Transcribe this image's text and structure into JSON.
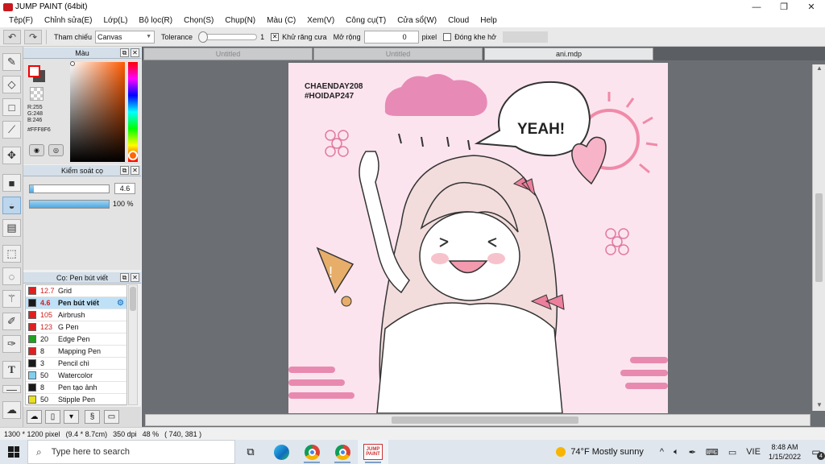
{
  "window": {
    "title": "JUMP PAINT (64bit)",
    "minimize": "—",
    "maximize": "❐",
    "close": "✕"
  },
  "menu": [
    "Tệp(F)",
    "Chỉnh sửa(E)",
    "Lớp(L)",
    "Bộ lọc(R)",
    "Chọn(S)",
    "Chụp(N)",
    "Màu (C)",
    "Xem(V)",
    "Công cụ(T)",
    "Cửa sổ(W)",
    "Cloud",
    "Help"
  ],
  "toolbar": {
    "reference_label": "Tham chiếu",
    "reference_value": "Canvas",
    "tolerance_label": "Tolerance",
    "tolerance_value": "1",
    "antialias_label": "Khử răng cưa",
    "antialias_checked": "✕",
    "expand_label": "Mở rộng",
    "expand_value": "0",
    "pixel_label": "pixel",
    "close_gap_label": "Đóng khe hở"
  },
  "color_panel": {
    "title": "Màu",
    "r": "R:255",
    "g": "G:248",
    "b": "B:246",
    "hex": "#FFF8F6"
  },
  "brush_control": {
    "title": "Kiểm soát cọ",
    "size_value": "4.6",
    "size_fraction": 0.05,
    "opacity_value": "100 %",
    "opacity_fraction": 1.0
  },
  "brush_panel": {
    "title": "Cọ: Pen bút viết",
    "brushes": [
      {
        "size": "12.7",
        "name": "Grid",
        "color": "#e02020",
        "size_red": true,
        "selected": false
      },
      {
        "size": "4.6",
        "name": "Pen bút viết",
        "color": "#1a1a1a",
        "size_red": true,
        "selected": true
      },
      {
        "size": "105",
        "name": "Airbrush",
        "color": "#e02020",
        "size_red": true,
        "selected": false
      },
      {
        "size": "123",
        "name": "G Pen",
        "color": "#e02020",
        "size_red": true,
        "selected": false
      },
      {
        "size": "20",
        "name": "Edge Pen",
        "color": "#20a020",
        "size_red": false,
        "selected": false
      },
      {
        "size": "8",
        "name": "Mapping Pen",
        "color": "#e02020",
        "size_red": false,
        "selected": false
      },
      {
        "size": "3",
        "name": "Pencil chì",
        "color": "#1a1a1a",
        "size_red": false,
        "selected": false
      },
      {
        "size": "50",
        "name": "Watercolor",
        "color": "#7fd0f0",
        "size_red": false,
        "selected": false
      },
      {
        "size": "8",
        "name": "Pen tạo ảnh",
        "color": "#1a1a1a",
        "size_red": false,
        "selected": false
      },
      {
        "size": "50",
        "name": "Stipple Pen",
        "color": "#e8e020",
        "size_red": false,
        "selected": false
      }
    ]
  },
  "tabs": [
    {
      "label": "Untitled",
      "active": false
    },
    {
      "label": "Untitled",
      "active": false
    },
    {
      "label": "ani.mdp",
      "active": true
    }
  ],
  "artwork": {
    "watermark_line1": "CHAENDAY208",
    "watermark_line2": "#HOIDAP247",
    "speech_text": "YEAH!",
    "exclaim": "!"
  },
  "status": {
    "size": "1300 * 1200 pixel",
    "physical": "(9.4 * 8.7cm)",
    "dpi": "350 dpi",
    "zoom": "48 %",
    "cursor": "( 740, 381 )"
  },
  "taskbar": {
    "search_placeholder": "Type here to search",
    "jump_icon_text": "JUMP PAINT",
    "weather": "74°F  Mostly sunny",
    "lang": "VIE",
    "time": "8:48 AM",
    "date": "1/15/2022",
    "notifications": "4"
  }
}
